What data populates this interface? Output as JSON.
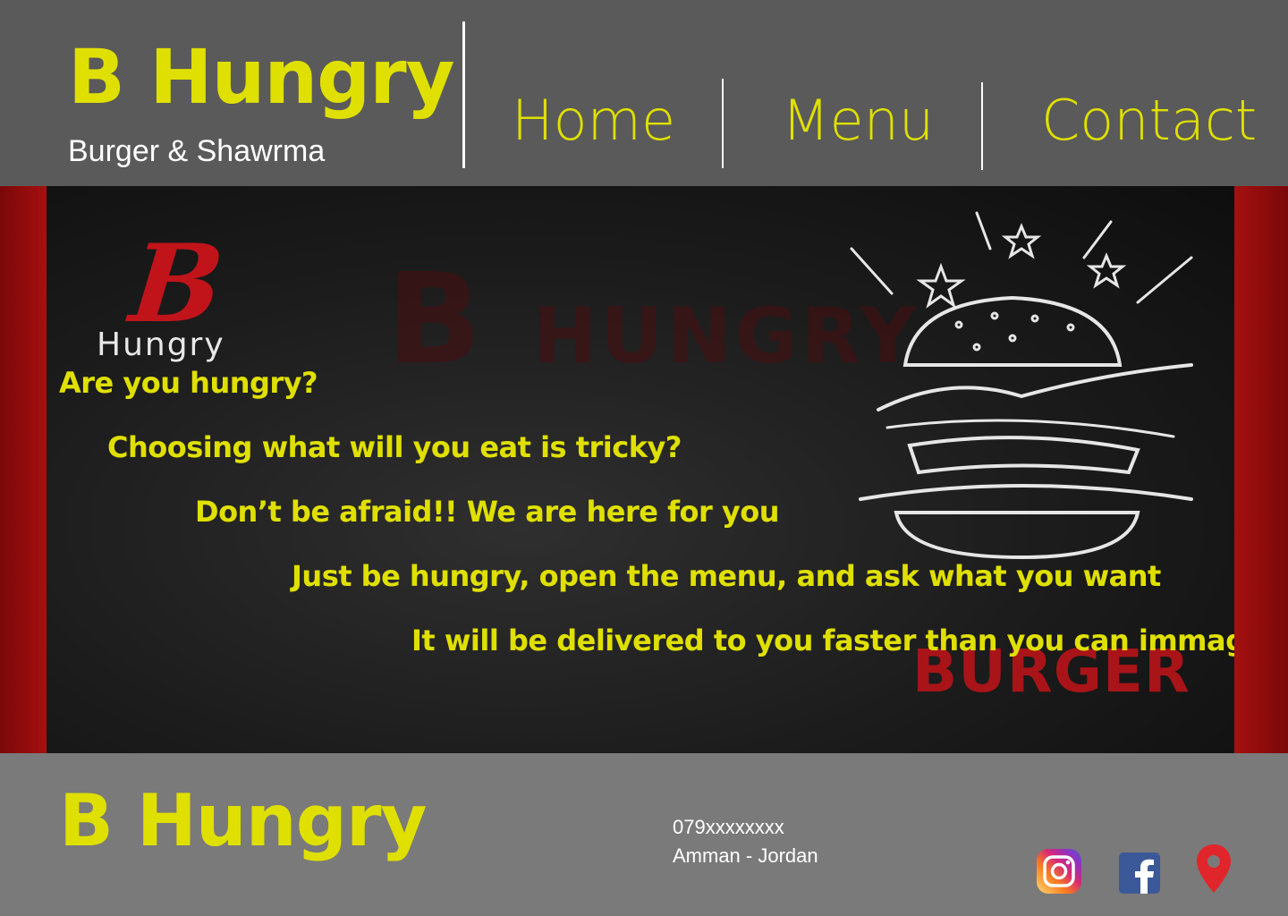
{
  "header": {
    "brand": "B Hungry",
    "tagline": "Burger & Shawrma",
    "nav": [
      {
        "label": "Home"
      },
      {
        "label": "Menu"
      },
      {
        "label": "Contact"
      }
    ]
  },
  "hero": {
    "logo_letter": "B",
    "logo_word": "Hungry",
    "watermark_b": "B",
    "watermark_word": "HUNGRY",
    "burger_word": "BURGER",
    "lines": [
      "Are you hungry?",
      "Choosing what will you eat is tricky?",
      "Don’t be afraid!! We are here for you",
      "Just be hungry, open the menu, and ask what you want",
      "It will be delivered to you faster than you can immagine"
    ]
  },
  "footer": {
    "brand": "B Hungry",
    "phone": "079xxxxxxxx",
    "address": "Amman - Jordan",
    "social": [
      {
        "icon": "instagram-icon"
      },
      {
        "icon": "facebook-icon"
      },
      {
        "icon": "location-pin-icon"
      }
    ]
  },
  "colors": {
    "accent": "#e0e000",
    "header_bg": "#5a5a5a",
    "footer_bg": "#7a7a7a",
    "brand_red": "#c0141a"
  }
}
